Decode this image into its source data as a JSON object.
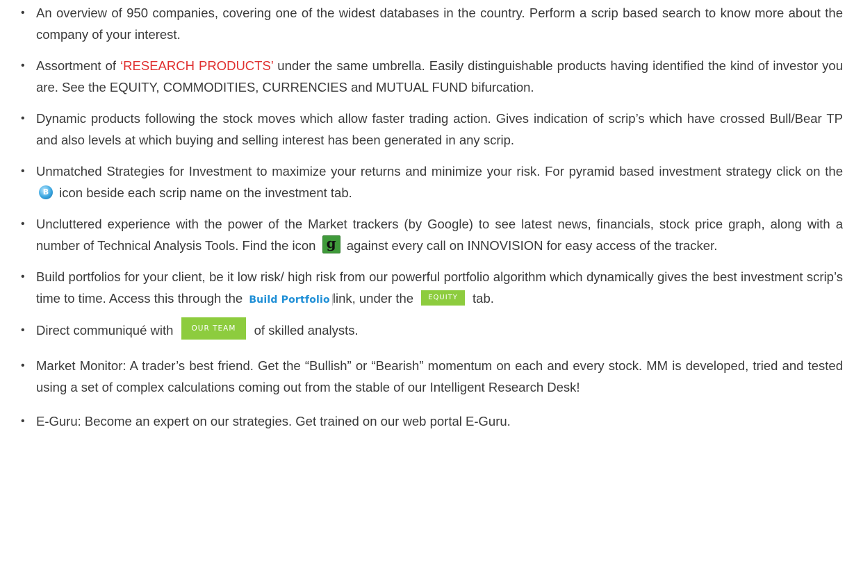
{
  "items": [
    {
      "text": "An overview of 950 companies, covering one of the widest databases in the country. Perform a scrip based search to know more about the company of your interest."
    },
    {
      "before": "Assortment of ",
      "highlight": "‘RESEARCH PRODUCTS’",
      "after": " under the same umbrella. Easily distinguishable products having identified the kind of investor you are. See the EQUITY, COMMODITIES, CURRENCIES and MUTUAL FUND bifurcation."
    },
    {
      "text": "Dynamic products following the stock moves which allow faster trading action. Gives indication of scrip’s which have crossed Bull/Bear TP and also levels at which buying and selling interest has been generated in any scrip."
    },
    {
      "before": "Unmatched Strategies for Investment to maximize your returns and minimize your risk. For pyramid based investment strategy click on the",
      "icon_glyph": "B",
      "icon_name": "pyramid-b-icon",
      "after": "icon beside each scrip name on the investment tab."
    },
    {
      "before": "Uncluttered experience with the power of the Market trackers (by Google) to see latest news, financials, stock price graph, along with a number of Technical Analysis Tools. Find the icon",
      "icon_glyph": "g",
      "icon_name": "google-tracker-icon",
      "after": "against every call on INNOVISION for easy access of the tracker."
    },
    {
      "before": "Build portfolios for your client, be it low risk/ high risk from our powerful portfolio algorithm which dynamically gives the best investment scrip’s time to time. Access this through the",
      "link_label": "Build Portfolio",
      "middle": "link, under the",
      "tab_label": "EQUITY",
      "after": "tab."
    },
    {
      "before": "Direct communiqué with",
      "button_label": "OUR TEAM",
      "after": "of skilled analysts."
    },
    {
      "text": "Market Monitor: A trader’s best friend. Get the “Bullish” or “Bearish” momentum on each and every stock. MM is developed, tried and tested using a set of complex calculations coming out from the stable of our Intelligent Research Desk!"
    },
    {
      "text": "E-Guru: Become an expert on our strategies. Get trained on our web portal E-Guru."
    }
  ],
  "bullet_glyph": "•",
  "colors": {
    "text": "#3a3a3a",
    "highlight": "#e03030",
    "link": "#1f8fd6",
    "tag_green": "#8dcc3e",
    "g_icon_green": "#3f9a3a",
    "b_icon_blue": "#3aa6e0"
  }
}
